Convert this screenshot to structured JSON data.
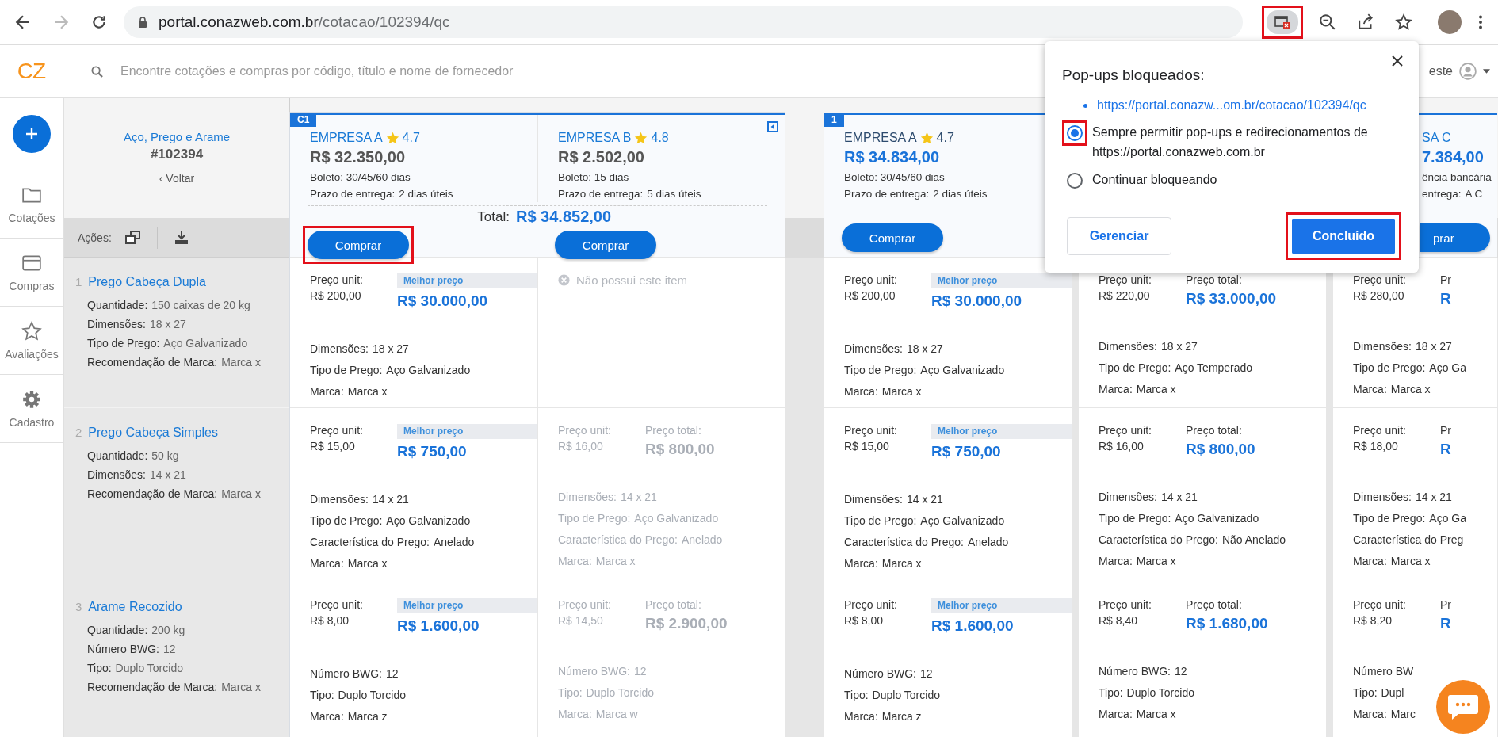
{
  "browser": {
    "url_host": "portal.conazweb.com.br",
    "url_path": "/cotacao/102394/qc",
    "popup_icon_highlighted": true
  },
  "app": {
    "logo": "CZ",
    "search_placeholder": "Encontre cotações e compras por código, título e nome de fornecedor",
    "user_name": "este"
  },
  "nav": {
    "items": [
      {
        "kind": "folder",
        "label": "Cotações"
      },
      {
        "kind": "card",
        "label": "Compras"
      },
      {
        "kind": "star",
        "label": "Avaliações"
      },
      {
        "kind": "gear",
        "label": "Cadastro"
      }
    ]
  },
  "quote": {
    "title": "Aço, Prego e Arame",
    "number": "#102394",
    "back": "‹ Voltar",
    "actions_label": "Ações:"
  },
  "items": [
    {
      "number": "1",
      "name": "Prego Cabeça Dupla",
      "attributes": [
        {
          "label": "Quantidade:",
          "value": "150 caixas de 20 kg"
        },
        {
          "label": "Dimensões:",
          "value": "18 x 27"
        },
        {
          "label": "Tipo de Prego:",
          "value": "Aço Galvanizado"
        },
        {
          "label": "Recomendação de Marca:",
          "value": "Marca x"
        }
      ]
    },
    {
      "number": "2",
      "name": "Prego Cabeça Simples",
      "attributes": [
        {
          "label": "Quantidade:",
          "value": "50 kg"
        },
        {
          "label": "Dimensões:",
          "value": "14 x 21"
        },
        {
          "label": "Recomendação de Marca:",
          "value": "Marca x"
        }
      ]
    },
    {
      "number": "3",
      "name": "Arame Recozido",
      "attributes": [
        {
          "label": "Quantidade:",
          "value": "200 kg"
        },
        {
          "label": "Número BWG:",
          "value": "12"
        },
        {
          "label": "Tipo:",
          "value": "Duplo Torcido"
        },
        {
          "label": "Recomendação de Marca:",
          "value": "Marca x"
        }
      ]
    }
  ],
  "groups": [
    {
      "badge": "C1",
      "collapsible": true,
      "total_label": "Total:",
      "total": "R$ 34.852,00",
      "suppliers": [
        {
          "header": {
            "kind": "full",
            "name": "EMPRESA A",
            "rating": "4.7",
            "linked": false,
            "price_accent": false,
            "price": "R$ 32.350,00",
            "payment": "Boleto: 30/45/60 dias",
            "delivery_label": "Prazo de entrega:",
            "delivery_value": "2 dias úteis",
            "buy": {
              "label": "Comprar",
              "highlighted": true
            }
          },
          "cells": [
            {
              "kind": "offer",
              "disabled": false,
              "unit_label": "Preço unit:",
              "unit_price": "R$ 200,00",
              "best_label": "Melhor preço",
              "total": "R$ 30.000,00",
              "attributes": [
                {
                  "label": "Dimensões:",
                  "value": "18 x 27"
                },
                {
                  "label": "Tipo de Prego:",
                  "value": "Aço Galvanizado"
                },
                {
                  "label": "Marca:",
                  "value": "Marca x"
                }
              ]
            },
            {
              "kind": "offer",
              "disabled": false,
              "unit_label": "Preço unit:",
              "unit_price": "R$ 15,00",
              "best_label": "Melhor preço",
              "total": "R$ 750,00",
              "attributes": [
                {
                  "label": "Dimensões:",
                  "value": "14 x 21"
                },
                {
                  "label": "Tipo de Prego:",
                  "value": "Aço Galvanizado"
                },
                {
                  "label": "Característica do Prego:",
                  "value": "Anelado"
                },
                {
                  "label": "Marca:",
                  "value": "Marca x"
                }
              ]
            },
            {
              "kind": "offer",
              "disabled": false,
              "unit_label": "Preço unit:",
              "unit_price": "R$ 8,00",
              "best_label": "Melhor preço",
              "total": "R$ 1.600,00",
              "attributes": [
                {
                  "label": "Número BWG:",
                  "value": "12"
                },
                {
                  "label": "Tipo:",
                  "value": "Duplo Torcido"
                },
                {
                  "label": "Marca:",
                  "value": "Marca z"
                }
              ]
            }
          ]
        },
        {
          "header": {
            "kind": "full",
            "name": "EMPRESA B",
            "rating": "4.8",
            "linked": false,
            "price_accent": false,
            "price": "R$ 2.502,00",
            "payment": "Boleto: 15 dias",
            "delivery_label": "Prazo de entrega:",
            "delivery_value": "5 dias úteis",
            "buy": {
              "label": "Comprar",
              "highlighted": false
            }
          },
          "cells": [
            {
              "kind": "missing",
              "text": "Não possui este item"
            },
            {
              "kind": "offer",
              "disabled": true,
              "unit_label": "Preço unit:",
              "unit_price": "R$ 16,00",
              "total_label": "Preço total:",
              "total": "R$ 800,00",
              "attributes": [
                {
                  "label": "Dimensões:",
                  "value": "14 x 21"
                },
                {
                  "label": "Tipo de Prego:",
                  "value": "Aço Galvanizado"
                },
                {
                  "label": "Característica do Prego:",
                  "value": "Anelado"
                },
                {
                  "label": "Marca:",
                  "value": "Marca x"
                }
              ]
            },
            {
              "kind": "offer",
              "disabled": true,
              "unit_label": "Preço unit:",
              "unit_price": "R$ 14,50",
              "total_label": "Preço total:",
              "total": "R$ 2.900,00",
              "attributes": [
                {
                  "label": "Número BWG:",
                  "value": "12"
                },
                {
                  "label": "Tipo:",
                  "value": "Duplo Torcido"
                },
                {
                  "label": "Marca:",
                  "value": "Marca w"
                }
              ]
            }
          ]
        }
      ]
    },
    {
      "badge": "1",
      "suppliers": [
        {
          "header": {
            "kind": "full",
            "name": "EMPRESA A",
            "rating": "4.7",
            "linked": true,
            "price_accent": true,
            "price": "R$ 34.834,00",
            "payment": "Boleto: 30/45/60 dias",
            "delivery_label": "Prazo de entrega:",
            "delivery_value": "2 dias úteis",
            "buy": {
              "label": "Comprar",
              "highlighted": false
            }
          },
          "cells": [
            {
              "kind": "offer",
              "disabled": false,
              "unit_label": "Preço unit:",
              "unit_price": "R$ 200,00",
              "best_label": "Melhor preço",
              "total": "R$ 30.000,00",
              "attributes": [
                {
                  "label": "Dimensões:",
                  "value": "18 x 27"
                },
                {
                  "label": "Tipo de Prego:",
                  "value": "Aço Galvanizado"
                },
                {
                  "label": "Marca:",
                  "value": "Marca x"
                }
              ]
            },
            {
              "kind": "offer",
              "disabled": false,
              "unit_label": "Preço unit:",
              "unit_price": "R$ 15,00",
              "best_label": "Melhor preço",
              "total": "R$ 750,00",
              "attributes": [
                {
                  "label": "Dimensões:",
                  "value": "14 x 21"
                },
                {
                  "label": "Tipo de Prego:",
                  "value": "Aço Galvanizado"
                },
                {
                  "label": "Característica do Prego:",
                  "value": "Anelado"
                },
                {
                  "label": "Marca:",
                  "value": "Marca x"
                }
              ]
            },
            {
              "kind": "offer",
              "disabled": false,
              "unit_label": "Preço unit:",
              "unit_price": "R$ 8,00",
              "best_label": "Melhor preço",
              "total": "R$ 1.600,00",
              "attributes": [
                {
                  "label": "Número BWG:",
                  "value": "12"
                },
                {
                  "label": "Tipo:",
                  "value": "Duplo Torcido"
                },
                {
                  "label": "Marca:",
                  "value": "Marca z"
                }
              ]
            }
          ]
        }
      ]
    },
    {
      "suppliers": [
        {
          "header": {
            "kind": "hidden"
          },
          "cells": [
            {
              "kind": "offer",
              "disabled": false,
              "unit_label": "Preço unit:",
              "unit_price": "R$ 220,00",
              "total_label": "Preço total:",
              "total": "R$ 33.000,00",
              "attributes": [
                {
                  "label": "Dimensões:",
                  "value": "18 x 27"
                },
                {
                  "label": "Tipo de Prego:",
                  "value": "Aço Temperado"
                },
                {
                  "label": "Marca:",
                  "value": "Marca x"
                }
              ]
            },
            {
              "kind": "offer",
              "disabled": false,
              "unit_label": "Preço unit:",
              "unit_price": "R$ 16,00",
              "total_label": "Preço total:",
              "total": "R$ 800,00",
              "attributes": [
                {
                  "label": "Dimensões:",
                  "value": "14 x 21"
                },
                {
                  "label": "Tipo de Prego:",
                  "value": "Aço Galvanizado"
                },
                {
                  "label": "Característica do Prego:",
                  "value": "Não Anelado"
                },
                {
                  "label": "Marca:",
                  "value": "Marca x"
                }
              ]
            },
            {
              "kind": "offer",
              "disabled": false,
              "unit_label": "Preço unit:",
              "unit_price": "R$ 8,40",
              "total_label": "Preço total:",
              "total": "R$ 1.680,00",
              "attributes": [
                {
                  "label": "Número BWG:",
                  "value": "12"
                },
                {
                  "label": "Tipo:",
                  "value": "Duplo Torcido"
                },
                {
                  "label": "Marca:",
                  "value": "Marca x"
                }
              ]
            }
          ]
        }
      ]
    },
    {
      "suppliers": [
        {
          "header": {
            "kind": "clipped",
            "name": "SA C",
            "price_accent": true,
            "price": "7.384,00",
            "payment": "ência bancária",
            "delivery_label": "entrega:",
            "delivery_value": "A C",
            "buy": {
              "label": "prar",
              "highlighted": false
            }
          },
          "cells": [
            {
              "kind": "offer",
              "disabled": false,
              "unit_label": "Preço unit:",
              "unit_price": "R$ 280,00",
              "total_label": "Pr",
              "total": "R",
              "attributes": [
                {
                  "label": "Dimensões:",
                  "value": "18 x 27"
                },
                {
                  "label": "Tipo de Prego:",
                  "value": "Aço Ga"
                },
                {
                  "label": "Marca:",
                  "value": "Marca x"
                }
              ]
            },
            {
              "kind": "offer",
              "disabled": false,
              "unit_label": "Preço unit:",
              "unit_price": "R$ 18,00",
              "total_label": "Pr",
              "total": "R",
              "attributes": [
                {
                  "label": "Dimensões:",
                  "value": "14 x 21"
                },
                {
                  "label": "Tipo de Prego:",
                  "value": "Aço Ga"
                },
                {
                  "label": "Característica do Preg"
                },
                {
                  "label": "Marca:",
                  "value": "Marca x"
                }
              ]
            },
            {
              "kind": "offer",
              "disabled": false,
              "unit_label": "Preço unit:",
              "unit_price": "R$ 8,20",
              "total_label": "Pr",
              "total": "R",
              "attributes": [
                {
                  "label": "Número BW"
                },
                {
                  "label": "Tipo:",
                  "value": "Dupl"
                },
                {
                  "label": "Marca:",
                  "value": "Marc"
                }
              ]
            }
          ]
        }
      ]
    }
  ],
  "popup": {
    "title": "Pop-ups bloqueados:",
    "link": "https://portal.conazw...om.br/cotacao/102394/qc",
    "options": [
      {
        "label": "Sempre permitir pop-ups e redirecionamentos de https://portal.conazweb.com.br",
        "selected": true,
        "highlighted": true
      },
      {
        "label": "Continuar bloqueando",
        "selected": false,
        "highlighted": false
      }
    ],
    "buttons": [
      {
        "kind": "secondary",
        "label": "Gerenciar",
        "highlighted": false
      },
      {
        "kind": "primary",
        "label": "Concluído",
        "highlighted": true
      }
    ]
  }
}
